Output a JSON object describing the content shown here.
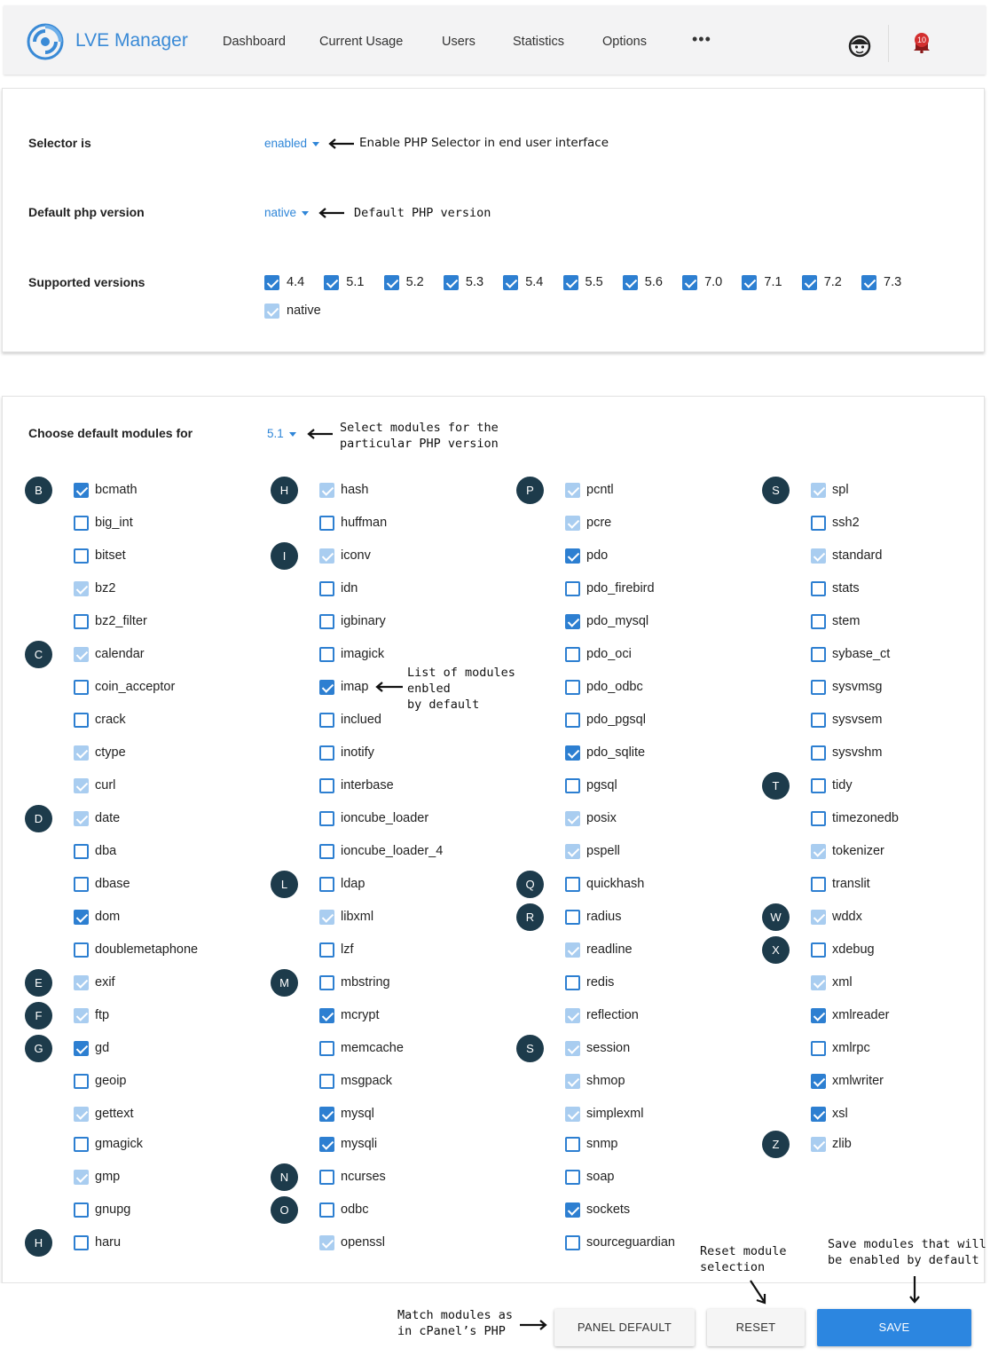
{
  "header": {
    "app_title": "LVE Manager",
    "nav": [
      "Dashboard",
      "Current Usage",
      "Users",
      "Statistics",
      "Options"
    ],
    "more_icon": "•••",
    "notification_count": "10",
    "accent_color": "#3a8ad6"
  },
  "selector": {
    "label": "Selector is",
    "value": "enabled",
    "annotation": "Enable PHP Selector in end user interface"
  },
  "default_version": {
    "label": "Default php version",
    "value": "native",
    "annotation": "Default PHP version"
  },
  "supported": {
    "label": "Supported versions",
    "versions": [
      {
        "v": "4.4",
        "state": "on"
      },
      {
        "v": "5.1",
        "state": "on"
      },
      {
        "v": "5.2",
        "state": "on"
      },
      {
        "v": "5.3",
        "state": "on"
      },
      {
        "v": "5.4",
        "state": "on"
      },
      {
        "v": "5.5",
        "state": "on"
      },
      {
        "v": "5.6",
        "state": "on"
      },
      {
        "v": "7.0",
        "state": "on"
      },
      {
        "v": "7.1",
        "state": "on"
      },
      {
        "v": "7.2",
        "state": "on"
      },
      {
        "v": "7.3",
        "state": "on"
      },
      {
        "v": "native",
        "state": "dis"
      }
    ]
  },
  "modules_section": {
    "label": "Choose default modules for",
    "value": "5.1",
    "annotation": "Select modules for the\nparticular PHP version",
    "list_annotation": "List of modules\nenbled\nby default"
  },
  "module_columns": [
    [
      {
        "letter": "B",
        "name": "bcmath",
        "state": "on"
      },
      {
        "name": "big_int",
        "state": "off"
      },
      {
        "name": "bitset",
        "state": "off"
      },
      {
        "name": "bz2",
        "state": "dis"
      },
      {
        "name": "bz2_filter",
        "state": "off"
      },
      {
        "letter": "C",
        "name": "calendar",
        "state": "dis"
      },
      {
        "name": "coin_acceptor",
        "state": "off"
      },
      {
        "name": "crack",
        "state": "off"
      },
      {
        "name": "ctype",
        "state": "dis"
      },
      {
        "name": "curl",
        "state": "dis"
      },
      {
        "letter": "D",
        "name": "date",
        "state": "dis"
      },
      {
        "name": "dba",
        "state": "off"
      },
      {
        "name": "dbase",
        "state": "off"
      },
      {
        "name": "dom",
        "state": "on"
      },
      {
        "name": "doublemetaphone",
        "state": "off"
      },
      {
        "letter": "E",
        "name": "exif",
        "state": "dis"
      },
      {
        "letter": "F",
        "name": "ftp",
        "state": "dis"
      },
      {
        "letter": "G",
        "name": "gd",
        "state": "on"
      },
      {
        "name": "geoip",
        "state": "off"
      },
      {
        "name": "gettext",
        "state": "dis"
      },
      {
        "name": "gmagick",
        "state": "off"
      },
      {
        "name": "gmp",
        "state": "dis"
      },
      {
        "name": "gnupg",
        "state": "off"
      },
      {
        "letter": "H",
        "name": "haru",
        "state": "off"
      }
    ],
    [
      {
        "letter": "H",
        "name": "hash",
        "state": "dis"
      },
      {
        "name": "huffman",
        "state": "off"
      },
      {
        "letter": "I",
        "name": "iconv",
        "state": "dis"
      },
      {
        "name": "idn",
        "state": "off"
      },
      {
        "name": "igbinary",
        "state": "off"
      },
      {
        "name": "imagick",
        "state": "off"
      },
      {
        "name": "imap",
        "state": "on"
      },
      {
        "name": "inclued",
        "state": "off"
      },
      {
        "name": "inotify",
        "state": "off"
      },
      {
        "name": "interbase",
        "state": "off"
      },
      {
        "name": "ioncube_loader",
        "state": "off"
      },
      {
        "name": "ioncube_loader_4",
        "state": "off"
      },
      {
        "letter": "L",
        "name": "ldap",
        "state": "off"
      },
      {
        "name": "libxml",
        "state": "dis"
      },
      {
        "name": "lzf",
        "state": "off"
      },
      {
        "letter": "M",
        "name": "mbstring",
        "state": "off"
      },
      {
        "name": "mcrypt",
        "state": "on"
      },
      {
        "name": "memcache",
        "state": "off"
      },
      {
        "name": "msgpack",
        "state": "off"
      },
      {
        "name": "mysql",
        "state": "on"
      },
      {
        "name": "mysqli",
        "state": "on"
      },
      {
        "letter": "N",
        "name": "ncurses",
        "state": "off"
      },
      {
        "letter": "O",
        "name": "odbc",
        "state": "off"
      },
      {
        "name": "openssl",
        "state": "dis"
      }
    ],
    [
      {
        "letter": "P",
        "name": "pcntl",
        "state": "dis"
      },
      {
        "name": "pcre",
        "state": "dis"
      },
      {
        "name": "pdo",
        "state": "on"
      },
      {
        "name": "pdo_firebird",
        "state": "off"
      },
      {
        "name": "pdo_mysql",
        "state": "on"
      },
      {
        "name": "pdo_oci",
        "state": "off"
      },
      {
        "name": "pdo_odbc",
        "state": "off"
      },
      {
        "name": "pdo_pgsql",
        "state": "off"
      },
      {
        "name": "pdo_sqlite",
        "state": "on"
      },
      {
        "name": "pgsql",
        "state": "off"
      },
      {
        "name": "posix",
        "state": "dis"
      },
      {
        "name": "pspell",
        "state": "dis"
      },
      {
        "letter": "Q",
        "name": "quickhash",
        "state": "off"
      },
      {
        "letter": "R",
        "name": "radius",
        "state": "off"
      },
      {
        "name": "readline",
        "state": "dis"
      },
      {
        "name": "redis",
        "state": "off"
      },
      {
        "name": "reflection",
        "state": "dis"
      },
      {
        "letter": "S",
        "name": "session",
        "state": "dis"
      },
      {
        "name": "shmop",
        "state": "dis"
      },
      {
        "name": "simplexml",
        "state": "dis"
      },
      {
        "name": "snmp",
        "state": "off"
      },
      {
        "name": "soap",
        "state": "off"
      },
      {
        "name": "sockets",
        "state": "on"
      },
      {
        "name": "sourceguardian",
        "state": "off"
      }
    ],
    [
      {
        "letter": "S",
        "name": "spl",
        "state": "dis"
      },
      {
        "name": "ssh2",
        "state": "off"
      },
      {
        "name": "standard",
        "state": "dis"
      },
      {
        "name": "stats",
        "state": "off"
      },
      {
        "name": "stem",
        "state": "off"
      },
      {
        "name": "sybase_ct",
        "state": "off"
      },
      {
        "name": "sysvmsg",
        "state": "off"
      },
      {
        "name": "sysvsem",
        "state": "off"
      },
      {
        "name": "sysvshm",
        "state": "off"
      },
      {
        "letter": "T",
        "name": "tidy",
        "state": "off"
      },
      {
        "name": "timezonedb",
        "state": "off"
      },
      {
        "name": "tokenizer",
        "state": "dis"
      },
      {
        "name": "translit",
        "state": "off"
      },
      {
        "letter": "W",
        "name": "wddx",
        "state": "dis"
      },
      {
        "letter": "X",
        "name": "xdebug",
        "state": "off"
      },
      {
        "name": "xml",
        "state": "dis"
      },
      {
        "name": "xmlreader",
        "state": "on"
      },
      {
        "name": "xmlrpc",
        "state": "off"
      },
      {
        "name": "xmlwriter",
        "state": "on"
      },
      {
        "name": "xsl",
        "state": "on"
      },
      {
        "letter": "Z",
        "name": "zlib",
        "state": "dis"
      }
    ]
  ],
  "footer": {
    "panel_default_annotation": "Match modules as\nin cPanel’s PHP",
    "reset_annotation": "Reset module\nselection",
    "save_annotation": "Save modules that will\nbe enabled by default",
    "panel_default_label": "PANEL DEFAULT",
    "reset_label": "RESET",
    "save_label": "SAVE"
  }
}
